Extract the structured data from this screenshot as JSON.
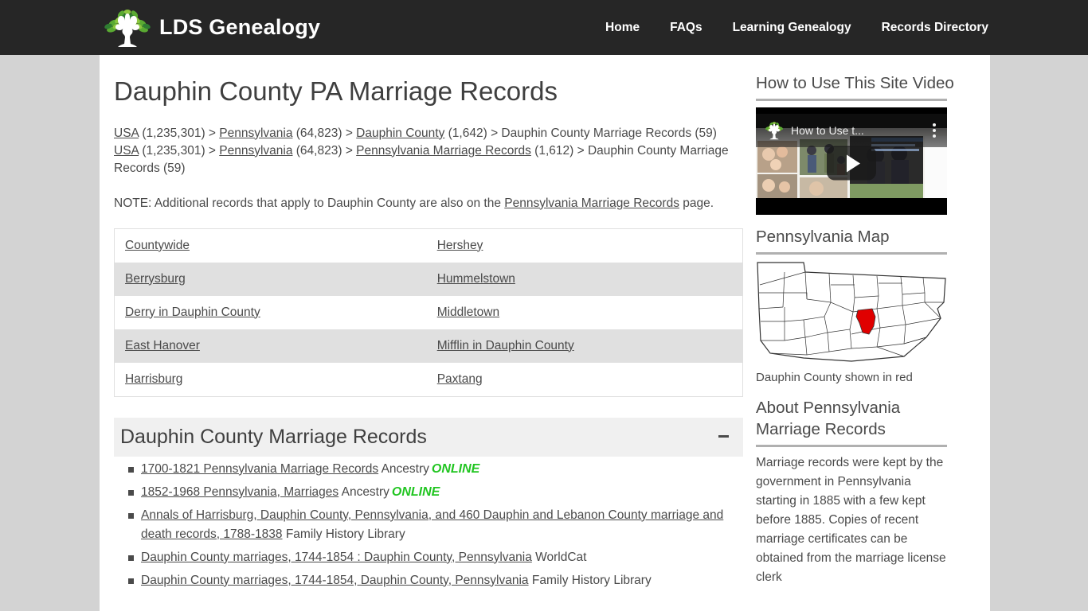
{
  "header": {
    "brand_name": "LDS Genealogy",
    "logo_icon": "tree-logo-icon",
    "nav": [
      {
        "label": "Home"
      },
      {
        "label": "FAQs"
      },
      {
        "label": "Learning Genealogy"
      },
      {
        "label": "Records Directory"
      }
    ]
  },
  "main": {
    "page_title": "Dauphin County PA Marriage Records",
    "breadcrumbs": [
      {
        "parts": [
          {
            "text": "USA",
            "link": true
          },
          {
            "text": " (1,235,301) > ",
            "link": false
          },
          {
            "text": "Pennsylvania",
            "link": true
          },
          {
            "text": " (64,823) > ",
            "link": false
          },
          {
            "text": "Dauphin County",
            "link": true
          },
          {
            "text": " (1,642) > Dauphin County Marriage Records (59)",
            "link": false
          }
        ]
      },
      {
        "parts": [
          {
            "text": "USA",
            "link": true
          },
          {
            "text": " (1,235,301) > ",
            "link": false
          },
          {
            "text": "Pennsylvania",
            "link": true
          },
          {
            "text": " (64,823) > ",
            "link": false
          },
          {
            "text": "Pennsylvania Marriage Records",
            "link": true
          },
          {
            "text": " (1,612) > Dauphin County Marriage Records (59)",
            "link": false
          }
        ]
      }
    ],
    "note": {
      "before": "NOTE: Additional records that apply to Dauphin County are also on the ",
      "link": "Pennsylvania Marriage Records",
      "after": " page."
    },
    "places_table": {
      "rows": [
        {
          "col1": "Countywide",
          "col2": "Hershey"
        },
        {
          "col1": "Berrysburg",
          "col2": "Hummelstown"
        },
        {
          "col1": "Derry in Dauphin County",
          "col2": "Middletown"
        },
        {
          "col1": "East Hanover",
          "col2": "Mifflin in Dauphin County"
        },
        {
          "col1": "Harrisburg",
          "col2": "Paxtang"
        }
      ]
    },
    "records_section": {
      "heading": "Dauphin County Marriage Records",
      "toggle_icon": "minus-icon",
      "items": [
        {
          "title": "1700-1821 Pennsylvania Marriage Records",
          "source": "Ancestry",
          "badge": "ONLINE"
        },
        {
          "title": "1852-1968 Pennsylvania, Marriages",
          "source": "Ancestry",
          "badge": "ONLINE"
        },
        {
          "title": "Annals of Harrisburg, Dauphin County, Pennsylvania, and 460 Dauphin and Lebanon County marriage and death records, 1788-1838",
          "source": "Family History Library",
          "badge": ""
        },
        {
          "title": "Dauphin County marriages, 1744-1854 : Dauphin County, Pennsylvania",
          "source": "WorldCat",
          "badge": ""
        },
        {
          "title": "Dauphin County marriages, 1744-1854, Dauphin County, Pennsylvania",
          "source": "Family History Library",
          "badge": ""
        }
      ]
    }
  },
  "sidebar": {
    "video_section": {
      "heading": "How to Use This Site Video",
      "video_title": "How to Use t...",
      "play_icon": "play-button-icon",
      "menu_icon": "kebab-menu-icon",
      "logo_icon": "tree-logo-icon"
    },
    "map_section": {
      "heading": "Pennsylvania Map",
      "caption": "Dauphin County shown in red",
      "highlight_color": "#e00000",
      "water_color": "#9a9ade"
    },
    "about_section": {
      "heading": "About Pennsylvania Marriage Records",
      "body": "Marriage records were kept by the government in Pennsylvania starting in 1885 with a few kept before 1885. Copies of recent marriage certificates can be obtained from the marriage license clerk"
    }
  },
  "colors": {
    "header_bg": "#262626",
    "page_bg": "#d3d3d3",
    "content_bg": "#ffffff",
    "online_green": "#21c521",
    "text": "#4a4a4a"
  }
}
